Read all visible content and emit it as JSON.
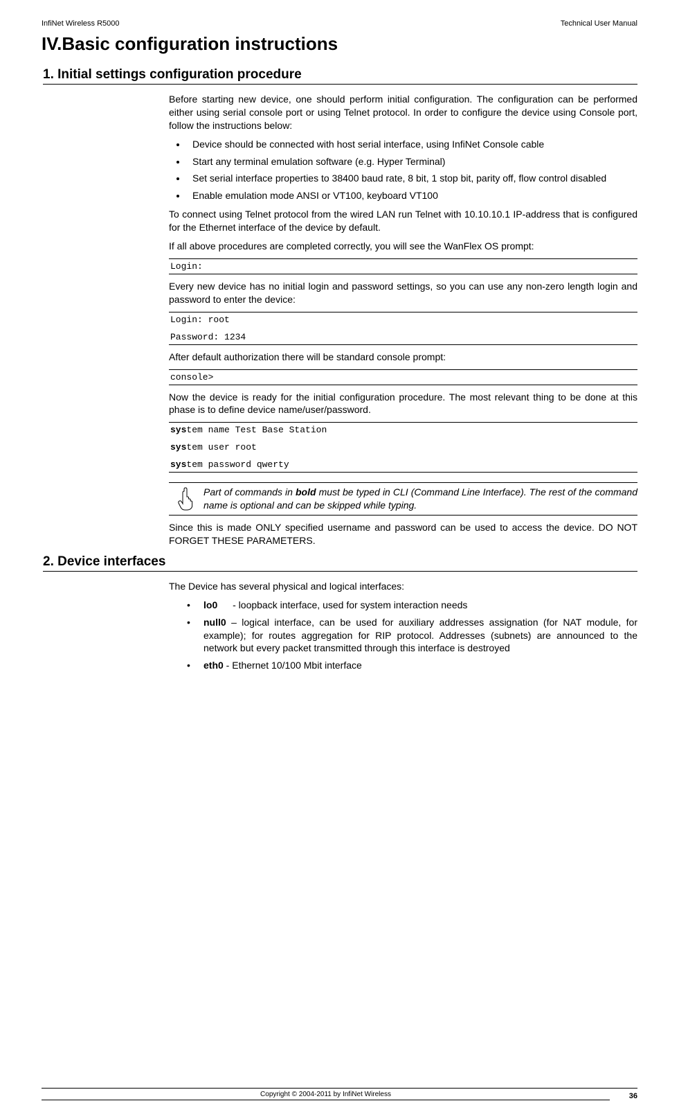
{
  "header": {
    "left": "InfiNet Wireless R5000",
    "right": "Technical User Manual"
  },
  "chapter": "IV.Basic configuration instructions",
  "s1": {
    "title": "1. Initial settings configuration procedure",
    "intro": "Before starting new device, one should perform initial configuration. The configuration can be performed either using serial console port or using Telnet protocol. In order to configure the device using Console port, follow the instructions below:",
    "bullets": [
      "Device should be connected with host serial interface, using InfiNet Console cable",
      "Start any terminal emulation software (e.g. Hyper Terminal)",
      "Set serial interface properties to 38400 baud rate, 8 bit, 1 stop bit, parity off, flow control disabled",
      "Enable emulation mode ANSI or VT100, keyboard VT100"
    ],
    "p_telnet": "To connect using Telnet protocol from the wired LAN run Telnet with 10.10.10.1 IP-address that is configured for the Ethernet interface of the device by default.",
    "p_prompt": "If all above procedures are completed correctly, you will see the WanFlex OS prompt:",
    "mono_login": "Login:",
    "p_nologin": "Every new device has no initial login and password settings, so you can use any non-zero length login and password to enter the device:",
    "mono_login_root": "Login: root",
    "mono_password": "Password: 1234",
    "p_default_auth": "After default authorization there will be standard console prompt:",
    "mono_console": " console>",
    "p_ready": "Now the device is ready for the initial configuration procedure. The most relevant thing to be done at this phase is to define device name/user/password.",
    "cmd_prefix": "sys",
    "cmd1_rest": "tem name Test Base Station",
    "cmd2_rest": "tem user root",
    "cmd3_rest": "tem password qwerty",
    "note_a": "Part of commands in ",
    "note_bold": "bold",
    "note_b": " must be typed in CLI (Command Line Interface). The rest of the command name is optional and can be skipped while typing.",
    "p_since": "Since this is made ONLY specified username and password can be used to access the device. DO NOT FORGET THESE PARAMETERS."
  },
  "s2": {
    "title": "2. Device interfaces",
    "p_intro": "The Device has several physical and logical interfaces:",
    "items": [
      {
        "name": "lo0",
        "after": " - loopback interface, used for system interaction needs",
        "gap": true
      },
      {
        "name": "null0",
        "after": " – logical interface, can be used for auxiliary addresses assignation (for NAT module, for example); for routes aggregation for RIP protocol. Addresses (subnets) are announced to the network but every packet transmitted through this interface is destroyed",
        "gap": false
      },
      {
        "name": "eth0",
        "after": " - Ethernet 10/100 Mbit interface",
        "gap": false
      }
    ]
  },
  "footer": {
    "copyright": "Copyright © 2004-2011 by InfiNet Wireless",
    "page": "36"
  },
  "icons": {
    "pointing_hand": "hand-icon"
  }
}
